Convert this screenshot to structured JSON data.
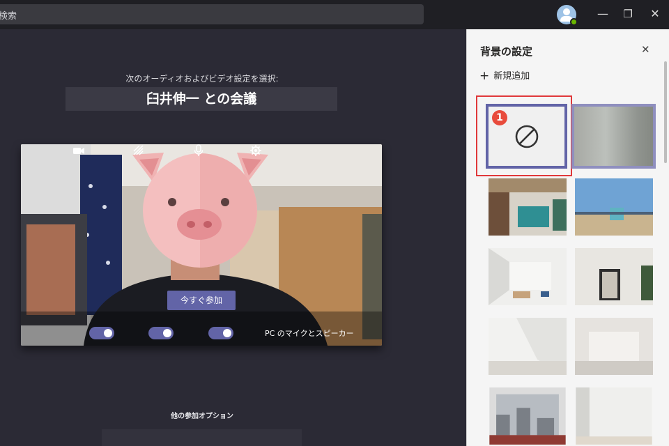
{
  "topbar": {
    "search_placeholder": "検索",
    "minimize": "—",
    "maximize": "❐",
    "close": "✕"
  },
  "prejoin": {
    "subtitle": "次のオーディオおよびビデオ設定を選択:",
    "title": "臼井伸一 との会議",
    "join_button": "今すぐ参加",
    "speaker_label": "PC のマイクとスピーカー",
    "camera_on": true,
    "blur_on": true,
    "mic_on": true,
    "other_options": "他の参加オプション"
  },
  "background_panel": {
    "title": "背景の設定",
    "close": "✕",
    "add_new": "新規追加",
    "badge": "1",
    "none_icon": "no-background-icon"
  },
  "colors": {
    "accent": "#6264a7",
    "highlight": "#e0383a"
  }
}
